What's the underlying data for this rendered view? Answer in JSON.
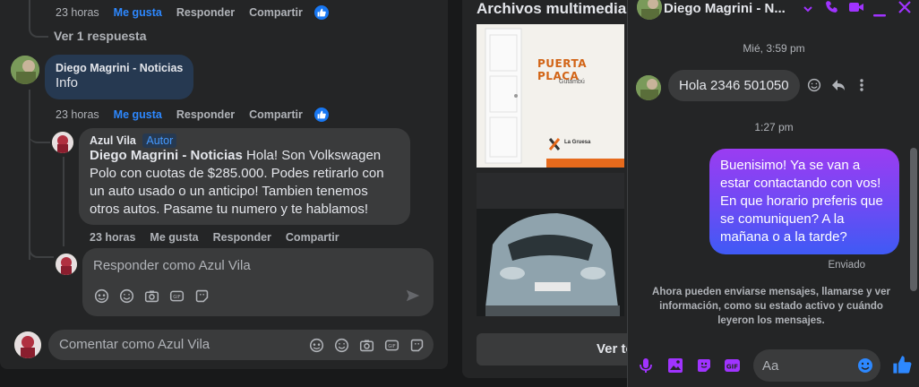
{
  "comments": {
    "first_actions": {
      "time": "23 horas",
      "like": "Me gusta",
      "reply": "Responder",
      "share": "Compartir"
    },
    "view_replies": "Ver 1 respuesta",
    "comment_diego": {
      "name": "Diego Magrini - Noticias",
      "text": "Info"
    },
    "second_actions": {
      "time": "23 horas",
      "like": "Me gusta",
      "reply": "Responder",
      "share": "Compartir"
    },
    "reply_azul": {
      "name": "Azul Vila",
      "badge": "Autor",
      "mention": "Diego Magrini - Noticias",
      "text": " Hola! Son Volkswagen Polo con cuotas de $285.000. Podes retirarlo con un auto usado o un anticipo! Tambien tenemos otros autos. Pasame tu numero y te hablamos!"
    },
    "third_actions": {
      "time": "23 horas",
      "like": "Me gusta",
      "reply": "Responder",
      "share": "Compartir"
    },
    "reply_placeholder": "Responder como Azul Vila",
    "comment_placeholder": "Comentar como Azul Vila"
  },
  "media": {
    "title": "Archivos multimedia r",
    "thumb1": {
      "title": "PUERTA PLACA",
      "subtitle": "Gutambú",
      "brand": "La Gruesa"
    },
    "button": "Ver to"
  },
  "chat": {
    "name": "Diego Magrini - N...",
    "ts1": "Mié, 3:59 pm",
    "received": "Hola 2346 501050",
    "ts2": "1:27 pm",
    "sent": "Buenisimo! Ya se van a estar contactando con vos! En que horario preferis que se comuniquen? A la mañana o a la tarde?",
    "status": "Enviado",
    "info": "Ahora pueden enviarse mensajes, llamarse y ver información, como su estado activo y cuándo leyeron los mensajes.",
    "input_placeholder": "Aa"
  },
  "colors": {
    "accent": "#a033ff",
    "blue": "#2d88ff",
    "bubble": "#3a3b3c"
  }
}
